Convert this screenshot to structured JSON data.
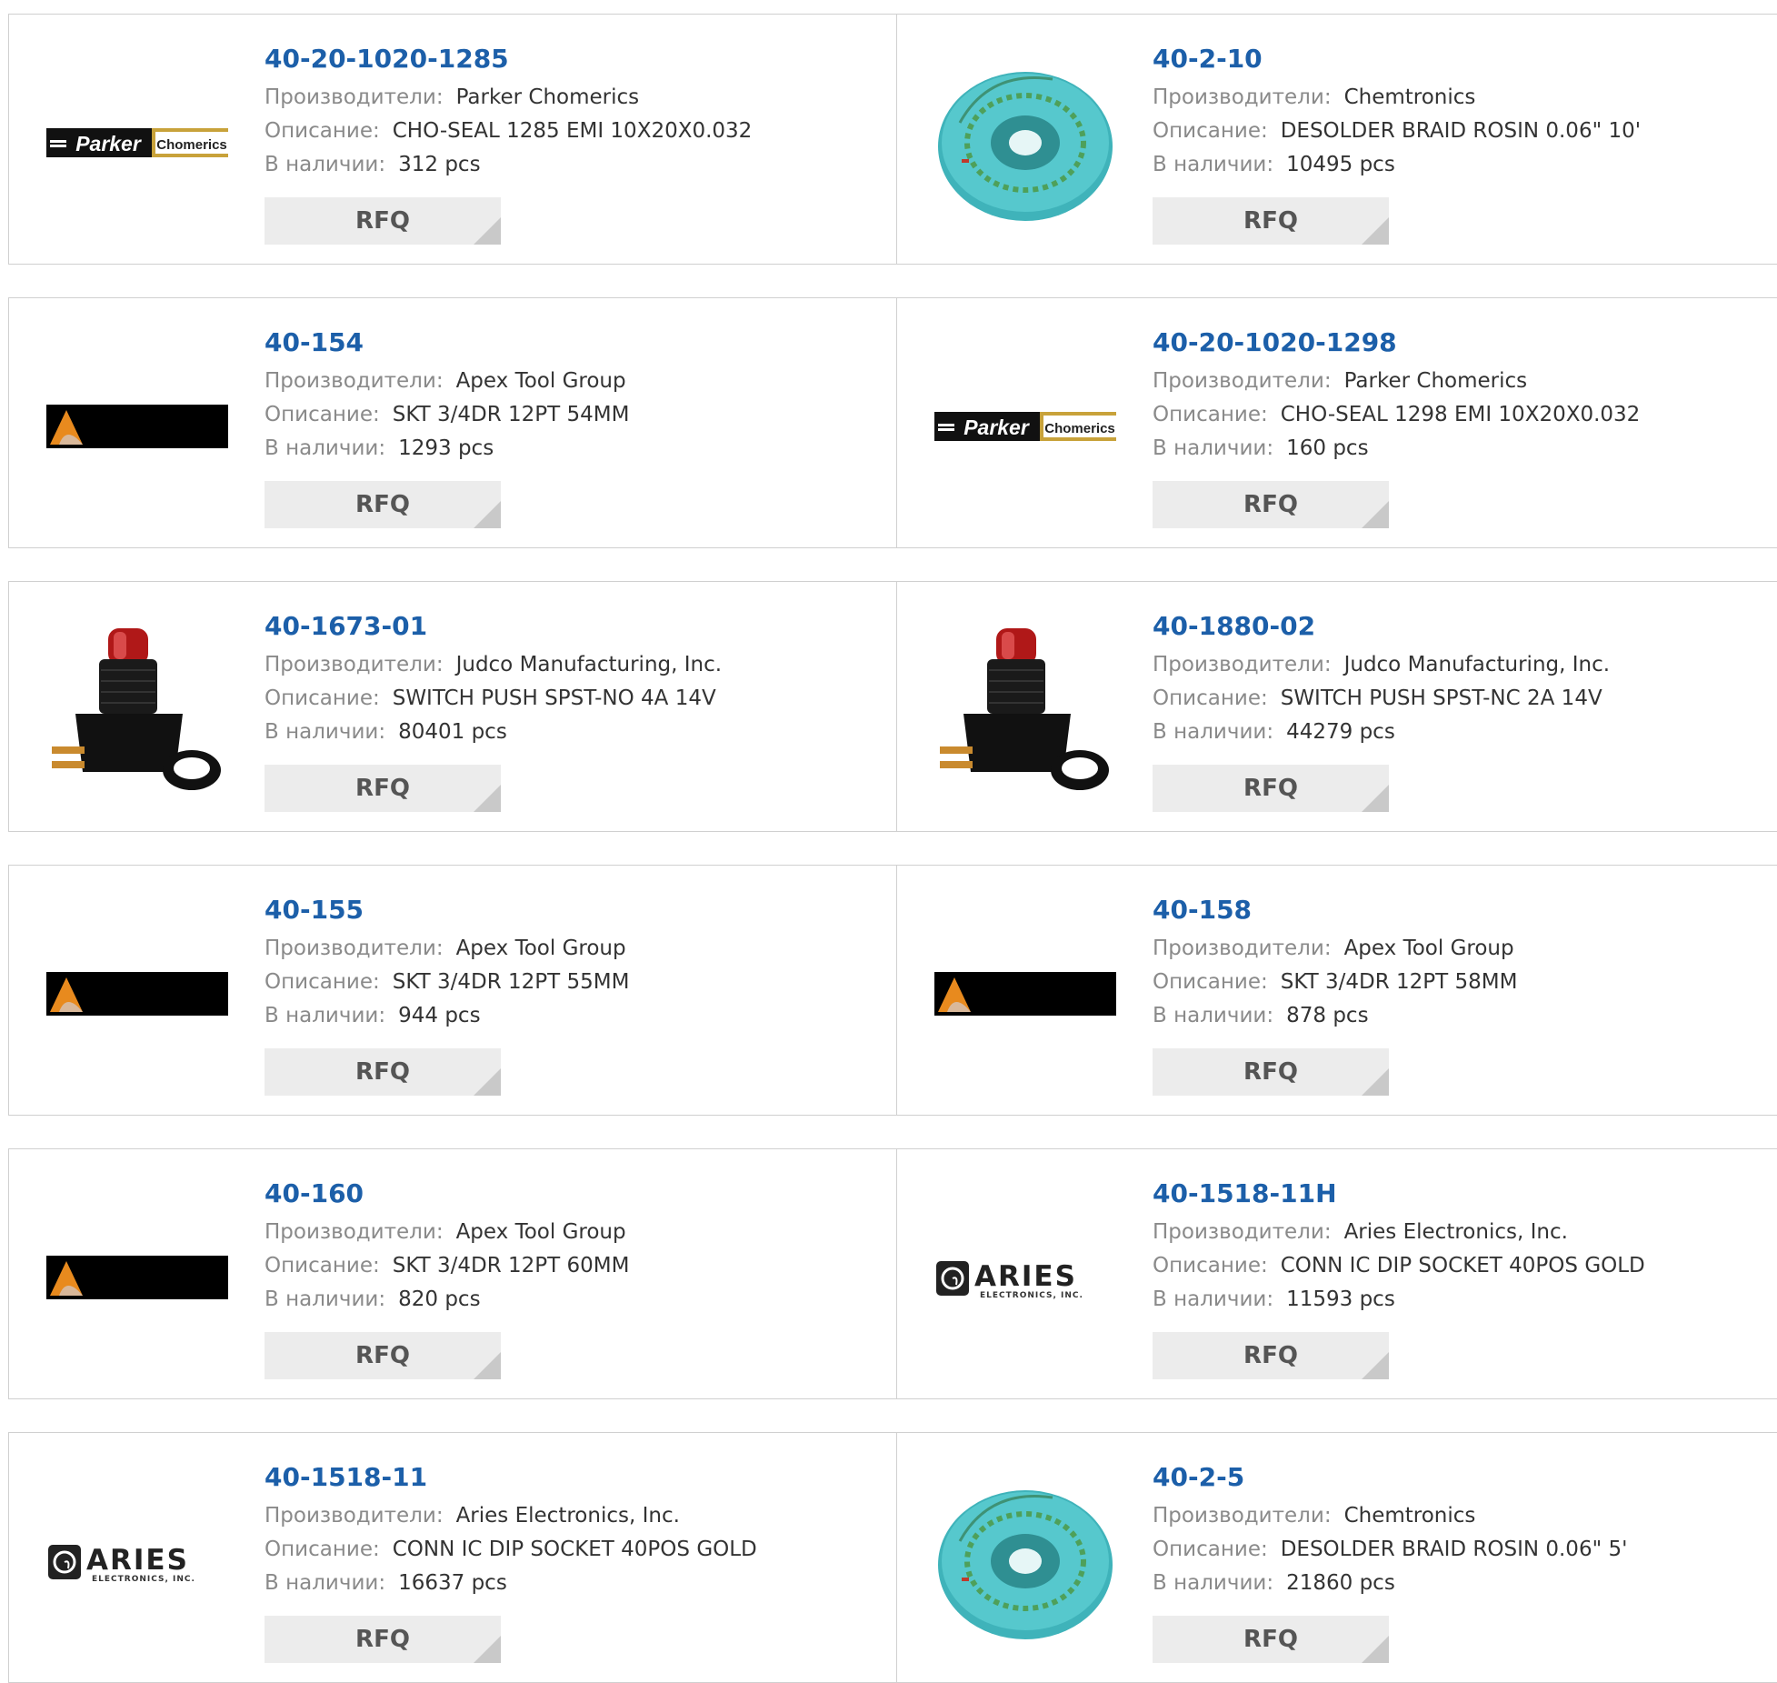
{
  "labels": {
    "manufacturer": "Производители:",
    "description": "Описание:",
    "stock": "В наличии:",
    "rfq": "RFQ"
  },
  "logos": {
    "parker_word": "Parker",
    "parker_sub": "Chomerics",
    "aries_word": "ARIES",
    "aries_sub": "ELECTRONICS, INC."
  },
  "colors": {
    "part_link": "#1c5fa9",
    "label_gray": "#8a8a8a",
    "value_text": "#333333",
    "rfq_bg": "#ececec",
    "border": "#d0d0d0"
  },
  "products": [
    {
      "part": "40-20-1020-1285",
      "manufacturer": "Parker Chomerics",
      "description": "CHO-SEAL 1285 EMI 10X20X0.032",
      "stock": "312 pcs",
      "image": "parker-chomerics-logo"
    },
    {
      "part": "40-2-10",
      "manufacturer": "Chemtronics",
      "description": "DESOLDER BRAID ROSIN 0.06\" 10'",
      "stock": "10495 pcs",
      "image": "desolder-braid-spool"
    },
    {
      "part": "40-154",
      "manufacturer": "Apex Tool Group",
      "description": "SKT 3/4DR 12PT 54MM",
      "stock": "1293 pcs",
      "image": "apex-tool-group-logo"
    },
    {
      "part": "40-20-1020-1298",
      "manufacturer": "Parker Chomerics",
      "description": "CHO-SEAL 1298 EMI 10X20X0.032",
      "stock": "160 pcs",
      "image": "parker-chomerics-logo"
    },
    {
      "part": "40-1673-01",
      "manufacturer": "Judco Manufacturing, Inc.",
      "description": "SWITCH PUSH SPST-NO 4A 14V",
      "stock": "80401 pcs",
      "image": "push-switch"
    },
    {
      "part": "40-1880-02",
      "manufacturer": "Judco Manufacturing, Inc.",
      "description": "SWITCH PUSH SPST-NC 2A 14V",
      "stock": "44279 pcs",
      "image": "push-switch"
    },
    {
      "part": "40-155",
      "manufacturer": "Apex Tool Group",
      "description": "SKT 3/4DR 12PT 55MM",
      "stock": "944 pcs",
      "image": "apex-tool-group-logo"
    },
    {
      "part": "40-158",
      "manufacturer": "Apex Tool Group",
      "description": "SKT 3/4DR 12PT 58MM",
      "stock": "878 pcs",
      "image": "apex-tool-group-logo"
    },
    {
      "part": "40-160",
      "manufacturer": "Apex Tool Group",
      "description": "SKT 3/4DR 12PT 60MM",
      "stock": "820 pcs",
      "image": "apex-tool-group-logo"
    },
    {
      "part": "40-1518-11H",
      "manufacturer": "Aries Electronics, Inc.",
      "description": "CONN IC DIP SOCKET 40POS GOLD",
      "stock": "11593 pcs",
      "image": "aries-electronics-logo"
    },
    {
      "part": "40-1518-11",
      "manufacturer": "Aries Electronics, Inc.",
      "description": "CONN IC DIP SOCKET 40POS GOLD",
      "stock": "16637 pcs",
      "image": "aries-electronics-logo"
    },
    {
      "part": "40-2-5",
      "manufacturer": "Chemtronics",
      "description": "DESOLDER BRAID ROSIN 0.06\" 5'",
      "stock": "21860 pcs",
      "image": "desolder-braid-spool"
    }
  ]
}
